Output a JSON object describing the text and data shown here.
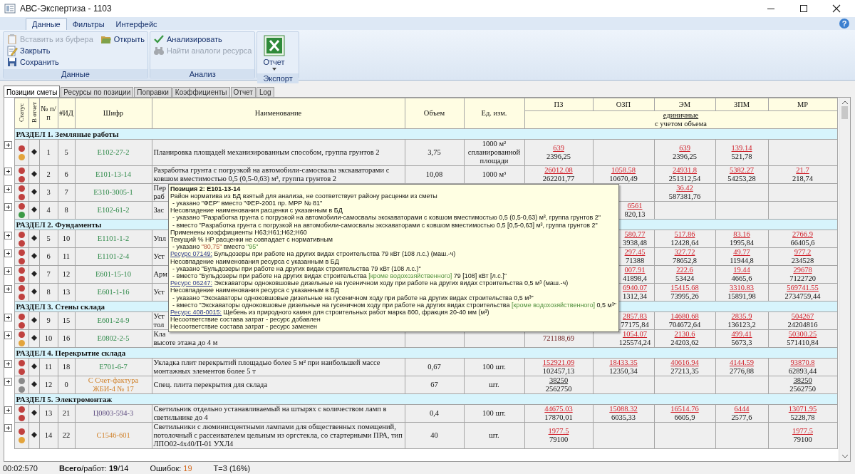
{
  "window": {
    "title": "АВС-Экспертиза - 1103",
    "help": "?"
  },
  "ribbon": {
    "tabs": [
      {
        "label": "Данные",
        "selected": true
      },
      {
        "label": "Фильтры",
        "selected": false
      },
      {
        "label": "Интерфейс",
        "selected": false
      }
    ],
    "groups": [
      {
        "label": "Данные",
        "kind": "list",
        "items": [
          {
            "label": "Вставить из буфера",
            "disabled": true
          },
          {
            "label": "Закрыть",
            "disabled": false
          },
          {
            "label": "Сохранить",
            "disabled": false
          },
          {
            "label": "Открыть",
            "disabled": false
          }
        ]
      },
      {
        "label": "Анализ",
        "kind": "list",
        "items": [
          {
            "label": "Анализировать",
            "disabled": false
          },
          {
            "label": "Найти аналоги ресурса",
            "disabled": true
          }
        ]
      },
      {
        "label": "Экспорт",
        "kind": "large",
        "items": [
          {
            "label": "Отчет",
            "disabled": false
          }
        ]
      }
    ]
  },
  "tabs": [
    {
      "label": "Позиции сметы",
      "selected": true
    },
    {
      "label": "Ресурсы по позиции",
      "selected": false
    },
    {
      "label": "Поправки",
      "selected": false
    },
    {
      "label": "Коэффициенты",
      "selected": false
    },
    {
      "label": "Отчет",
      "selected": false
    },
    {
      "label": "Log",
      "selected": false
    }
  ],
  "table": {
    "columns": [
      "Статус",
      "В отчет",
      "№ п/п",
      "#ИД",
      "Шифр",
      "Наименование",
      "Объем",
      "Ед. изм.",
      "ПЗ",
      "ОЗП",
      "ЭМ",
      "ЗПМ",
      "МР"
    ],
    "cost_header": {
      "top": "единичные",
      "bottom": "с учетом объема"
    },
    "rows": [
      {
        "kind": "section",
        "title": "РАЗДЕЛ 1. Земляные работы"
      },
      {
        "kind": "position",
        "expanded": false,
        "status": [
          {
            "color": "#c0413f"
          },
          {
            "color": "#e3a43c"
          }
        ],
        "in_report": true,
        "num": "1",
        "id": "5",
        "code": {
          "text": "E102-27-2",
          "kind": "estimate"
        },
        "name": "Планировка площадей механизированным способом, группа грунтов 2",
        "qty": "3,75",
        "unit": "1000 м² спланированной площади",
        "costs": {
          "pz": {
            "unit": "639",
            "total": "2396,25",
            "mismatch": true
          },
          "em": {
            "unit": "639",
            "total": "2396,25",
            "mismatch": true
          },
          "zpm": {
            "unit": "139.14",
            "total": "521,78",
            "mismatch": true
          }
        }
      },
      {
        "kind": "position",
        "expanded": false,
        "status": [
          {
            "color": "#c0413f"
          },
          {
            "color": "#c0413f"
          }
        ],
        "in_report": true,
        "num": "2",
        "id": "6",
        "code": {
          "text": "E101-13-14",
          "kind": "estimate"
        },
        "name": "Разработка грунта с погрузкой на автомобили-самосвалы экскаваторами с ковшом вместимостью 0,5 (0,5-0,63) м³, группа грунтов 2",
        "qty": "10,08",
        "unit": "1000 м³",
        "costs": {
          "pz": {
            "unit": "26012.08",
            "total": "262201,77",
            "mismatch": true
          },
          "ozp": {
            "unit": "1058.58",
            "total": "10670,49",
            "mismatch": true
          },
          "em": {
            "unit": "24931.8",
            "total": "251312,54",
            "mismatch": true
          },
          "zpm": {
            "unit": "5382.27",
            "total": "54253,28",
            "mismatch": true
          },
          "mr": {
            "unit": "21.7",
            "total": "218,74",
            "mismatch": true
          }
        }
      },
      {
        "kind": "position",
        "expanded": false,
        "status": [
          {
            "color": "#c0413f"
          },
          {
            "color": "#c0413f"
          }
        ],
        "in_report": true,
        "num": "3",
        "id": "7",
        "code": {
          "text": "E310-3005-1",
          "kind": "estimate"
        },
        "name_lines": [
          "Пер",
          "раб"
        ],
        "costs": {
          "em": {
            "unit": "36.42",
            "total": "587381,76",
            "mismatch": true
          }
        }
      },
      {
        "kind": "position",
        "expanded": false,
        "status": [
          {
            "color": "#c0413f"
          },
          {
            "color": "#3c9a46"
          }
        ],
        "in_report": true,
        "num": "4",
        "id": "8",
        "code": {
          "text": "E102-61-2",
          "kind": "estimate"
        },
        "name_lines": [
          "Зас"
        ],
        "costs": {
          "ozp": {
            "unit": "6561",
            "total": "820,13",
            "mismatch": true,
            "cut": true
          }
        }
      },
      {
        "kind": "section",
        "title": "РАЗДЕЛ 2. Фундаменты"
      },
      {
        "kind": "position",
        "expanded": false,
        "status": [
          {
            "color": "#c0413f"
          },
          {
            "color": "#c0413f"
          }
        ],
        "in_report": true,
        "num": "5",
        "id": "10",
        "code": {
          "text": "E1101-1-2",
          "kind": "estimate"
        },
        "name_lines": [
          "Упл"
        ],
        "costs": {
          "ozp": {
            "unit": "580.77",
            "total": "3938,48",
            "mismatch": true,
            "cut": true
          },
          "em": {
            "unit": "517.86",
            "total": "12428,64",
            "mismatch": true
          },
          "zpm": {
            "unit": "83.16",
            "total": "1995,84",
            "mismatch": true
          },
          "mr": {
            "unit": "2766.9",
            "total": "66405,6",
            "mismatch": true
          }
        }
      },
      {
        "kind": "position",
        "expanded": false,
        "status": [
          {
            "color": "#c0413f"
          },
          {
            "color": "#c0413f"
          }
        ],
        "in_report": true,
        "num": "6",
        "id": "11",
        "code": {
          "text": "E1101-2-4",
          "kind": "estimate"
        },
        "name_lines": [
          "Уст"
        ],
        "costs": {
          "ozp": {
            "unit": "297.45",
            "total": "71388",
            "mismatch": true,
            "cut": true
          },
          "em": {
            "unit": "327.72",
            "total": "78652,8",
            "mismatch": true
          },
          "zpm": {
            "unit": "49.77",
            "total": "11944,8",
            "mismatch": true
          },
          "mr": {
            "unit": "977.2",
            "total": "234528",
            "mismatch": true
          }
        }
      },
      {
        "kind": "position",
        "expanded": false,
        "status": [
          {
            "color": "#c0413f"
          },
          {
            "color": "#c0413f"
          }
        ],
        "in_report": true,
        "num": "7",
        "id": "12",
        "code": {
          "text": "E601-15-10",
          "kind": "estimate"
        },
        "name_lines": [
          "Арм"
        ],
        "costs": {
          "ozp": {
            "unit": "007.91",
            "total": "41898,4",
            "mismatch": true,
            "cut": true
          },
          "em": {
            "unit": "222.6",
            "total": "53424",
            "mismatch": true
          },
          "zpm": {
            "unit": "19.44",
            "total": "4665,6",
            "mismatch": true
          },
          "mr": {
            "unit": "29678",
            "total": "7122720",
            "mismatch": true
          }
        }
      },
      {
        "kind": "position",
        "expanded": false,
        "status": [
          {
            "color": "#c0413f"
          },
          {
            "color": "#c0413f"
          }
        ],
        "in_report": true,
        "num": "8",
        "id": "13",
        "code": {
          "text": "E601-1-16",
          "kind": "estimate"
        },
        "name_lines": [
          "Уст"
        ],
        "costs": {
          "ozp": {
            "unit": "6940.07",
            "total": "1312,34",
            "mismatch": true,
            "cut": true
          },
          "em": {
            "unit": "15415.68",
            "total": "73995,26",
            "mismatch": true
          },
          "zpm": {
            "unit": "3310.83",
            "total": "15891,98",
            "mismatch": true
          },
          "mr": {
            "unit": "569741.55",
            "total": "2734759,44",
            "mismatch": true
          }
        }
      },
      {
        "kind": "section",
        "title": "РАЗДЕЛ 3. Стены склада"
      },
      {
        "kind": "position",
        "expanded": false,
        "status": [
          {
            "color": "#c0413f"
          },
          {
            "color": "#c0413f"
          }
        ],
        "in_report": true,
        "num": "9",
        "id": "15",
        "code": {
          "text": "E601-24-9",
          "kind": "estimate"
        },
        "name_lines": [
          "Уст",
          "тол"
        ],
        "costs": {
          "ozp": {
            "unit": "2857.83",
            "total": "77175,84",
            "mismatch": true,
            "cut": true
          },
          "em": {
            "unit": "14680.68",
            "total": "704672,64",
            "mismatch": true
          },
          "zpm": {
            "unit": "2835.9",
            "total": "136123,2",
            "mismatch": true
          },
          "mr": {
            "unit": "504267",
            "total": "24204816",
            "mismatch": true
          }
        }
      },
      {
        "kind": "position",
        "expanded": false,
        "status": [
          {
            "color": "#c0413f"
          },
          {
            "color": "#e3a43c"
          }
        ],
        "in_report": true,
        "num": "10",
        "id": "16",
        "code": {
          "text": "E0802-2-5",
          "kind": "estimate"
        },
        "name_lines": [
          "Кла",
          "высоте этажа до 4 м"
        ],
        "costs": {
          "pz": {
            "total": "721188,69",
            "mismatch": true
          },
          "ozp": {
            "unit": "1054.07",
            "total": "125574,24",
            "mismatch": true,
            "cut": true
          },
          "em": {
            "unit": "2130.6",
            "total": "24203,62",
            "mismatch": true
          },
          "zpm": {
            "unit": "499.41",
            "total": "5673,3",
            "mismatch": true
          },
          "mr": {
            "unit": "50300.25",
            "total": "571410,84",
            "mismatch": true
          }
        }
      },
      {
        "kind": "section",
        "title": "РАЗДЕЛ 4. Перекрытие склада"
      },
      {
        "kind": "position",
        "expanded": false,
        "status": [
          {
            "color": "#c0413f"
          },
          {
            "color": "#c0413f"
          }
        ],
        "in_report": true,
        "num": "11",
        "id": "18",
        "code": {
          "text": "E701-6-7",
          "kind": "estimate"
        },
        "name": "Укладка плит перекрытий площадью более 5 м² при наибольшей массе монтажных элементов более 5 т",
        "qty": "0,67",
        "unit": "100 шт.",
        "costs": {
          "pz": {
            "unit": "152921.09",
            "total": "102457,13",
            "mismatch": true
          },
          "ozp": {
            "unit": "18433.35",
            "total": "12350,34",
            "mismatch": true
          },
          "em": {
            "unit": "40616.94",
            "total": "27213,35",
            "mismatch": true
          },
          "zpm": {
            "unit": "4144.59",
            "total": "2776,88",
            "mismatch": true
          },
          "mr": {
            "unit": "93870.8",
            "total": "62893,44",
            "mismatch": true
          }
        }
      },
      {
        "kind": "position",
        "expanded": false,
        "status": [
          {
            "color": "#8a8a8a"
          },
          {
            "color": "#8a8a8a"
          }
        ],
        "in_report": true,
        "num": "12",
        "id": "0",
        "code": {
          "text": "С Счет-фактура ЖБИ-4 № 17",
          "kind": "invoice"
        },
        "name": "Спец. плита перекрытия для склада",
        "qty": "67",
        "unit": "шт.",
        "costs": {
          "pz": {
            "unit": "38250",
            "total": "2562750",
            "mismatch": false
          },
          "mr": {
            "unit": "38250",
            "total": "2562750",
            "mismatch": false
          }
        }
      },
      {
        "kind": "section",
        "title": "РАЗДЕЛ 5. Электромонтаж"
      },
      {
        "kind": "position",
        "expanded": false,
        "status": [
          {
            "color": "#c0413f"
          },
          {
            "color": "#c0413f"
          }
        ],
        "in_report": true,
        "num": "13",
        "id": "21",
        "code": {
          "text": "Ц0803-594-3",
          "kind": "other"
        },
        "name": "Светильник отдельно устанавливаемый на штырях с количеством ламп в светильнике до 4",
        "qty": "0,4",
        "unit": "100 шт.",
        "costs": {
          "pz": {
            "unit": "44675.03",
            "total": "17870,01",
            "mismatch": true
          },
          "ozp": {
            "unit": "15088.32",
            "total": "6035,33",
            "mismatch": true
          },
          "em": {
            "unit": "16514.76",
            "total": "6605,9",
            "mismatch": true
          },
          "zpm": {
            "unit": "6444",
            "total": "2577,6",
            "mismatch": true
          },
          "mr": {
            "unit": "13071.95",
            "total": "5228,78",
            "mismatch": true
          }
        }
      },
      {
        "kind": "position",
        "expanded": false,
        "status": [
          {
            "color": "#c0413f"
          },
          {
            "color": "#e3a43c"
          }
        ],
        "in_report": true,
        "num": "14",
        "id": "22",
        "code": {
          "text": "C1546-601",
          "kind": "invoice"
        },
        "name": "Светильники с люминисцентными лампами для общественных помещений, потолочный с рассеивателем цельным из оргстекла, со стартерными ПРА, тип ЛПО02-4х40/П-01 УХЛ4",
        "qty": "40",
        "unit": "шт.",
        "costs": {
          "pz": {
            "unit": "1977.5",
            "total": "79100",
            "mismatch": true
          },
          "mr": {
            "unit": "1977.5",
            "total": "79100",
            "mismatch": true
          }
        }
      }
    ]
  },
  "tooltip": {
    "title": "Позиция 2: E101-13-14",
    "lines": [
      {
        "kind": "note",
        "parts": [
          {
            "text": "Район норматива из БД взятый для анализа, не соответствует району расценки из сметы"
          }
        ]
      },
      {
        "kind": "detail",
        "parts": [
          {
            "text": "- указано \"ФЕР\" вместо \"ФЕР-2001 пр. МРР № 81\""
          }
        ]
      },
      {
        "kind": "note",
        "parts": [
          {
            "text": "Несовпадение наименования расценки с указанным в БД"
          }
        ]
      },
      {
        "kind": "detail",
        "parts": [
          {
            "text": "- указано \"Разработка грунта с погрузкой на автомобили-самосвалы экскаваторами с ковшом вместимостью 0,5 (0,5-0,63) м³, группа грунтов 2\""
          }
        ]
      },
      {
        "kind": "detail",
        "parts": [
          {
            "text": "- вместо \"Разработка грунта с погрузкой на автомобили-самосвалы экскаваторами с ковшом вместимостью 0,5 [0,5-0,63] м³, группа грунтов 2\""
          }
        ]
      },
      {
        "kind": "note",
        "parts": [
          {
            "text": "Применены коэффициенты Н63;Н61;Н62;Н60"
          }
        ]
      },
      {
        "kind": "note",
        "parts": [
          {
            "text": "Текущий % НР расценки не совпадает с нормативным"
          }
        ]
      },
      {
        "kind": "detail",
        "parts": [
          {
            "text": "- указано ",
            "kind": "plain"
          },
          {
            "text": "\"80,75\"",
            "kind": "old"
          },
          {
            "text": " вместо ",
            "kind": "plain"
          },
          {
            "text": "\"95\"",
            "kind": "new"
          }
        ]
      },
      {
        "kind": "resource",
        "link": "Ресурс 07149:",
        "parts": [
          {
            "text": " Бульдозеры при работе на других видах строительства 79 кВт (108 л.с.) (маш.-ч)"
          }
        ]
      },
      {
        "kind": "note",
        "parts": [
          {
            "text": "Несовпадение наименования ресурса с указанным в БД"
          }
        ]
      },
      {
        "kind": "detail",
        "parts": [
          {
            "text": "- указано \"Бульдозеры при работе на других видах строительства 79 кВт (108 л.с.)\""
          }
        ]
      },
      {
        "kind": "detail",
        "parts": [
          {
            "text": "- вместо \"Бульдозеры при работе на других видах строительства ",
            "kind": "plain"
          },
          {
            "text": "[кроме водохозяйственного]",
            "kind": "new"
          },
          {
            "text": " 79 [108] кВт [л.с.]\"",
            "kind": "plain"
          }
        ]
      },
      {
        "kind": "resource",
        "link": "Ресурс 06247:",
        "parts": [
          {
            "text": " Экскаваторы одноковшовые дизельные на гусеничном ходу при работе на других видах строительства 0,5 м³ (маш.-ч)"
          }
        ]
      },
      {
        "kind": "note",
        "parts": [
          {
            "text": "Несовпадение наименования ресурса с указанным в БД"
          }
        ]
      },
      {
        "kind": "detail",
        "parts": [
          {
            "text": "- указано \"Экскаваторы одноковшовые дизельные на гусеничном ходу при работе на других видах строительства 0,5 м³\""
          }
        ]
      },
      {
        "kind": "detail",
        "parts": [
          {
            "text": "- вместо \"Экскаваторы одноковшовые дизельные на гусеничном ходу при работе на других видах строительства ",
            "kind": "plain"
          },
          {
            "text": "[кроме водохозяйственного]",
            "kind": "new"
          },
          {
            "text": " 0,5 м³\"",
            "kind": "plain"
          }
        ]
      },
      {
        "kind": "resource",
        "link": "Ресурс 408-0015:",
        "parts": [
          {
            "text": " Щебень из природного камня для строительных работ марка 800, фракция 20-40 мм (м³)"
          }
        ]
      },
      {
        "kind": "note",
        "parts": [
          {
            "text": "Несоответствие состава затрат - ресурс добавлен"
          }
        ]
      },
      {
        "kind": "note",
        "parts": [
          {
            "text": "Несоответствие состава затрат - ресурс заменен"
          }
        ]
      }
    ]
  },
  "status_bar": {
    "time": "00:02:570",
    "totals": "**Всего**/работ: **19**/14",
    "errors_label": "Ошибок:",
    "errors": "19",
    "threads": "T=3 (16%)"
  }
}
